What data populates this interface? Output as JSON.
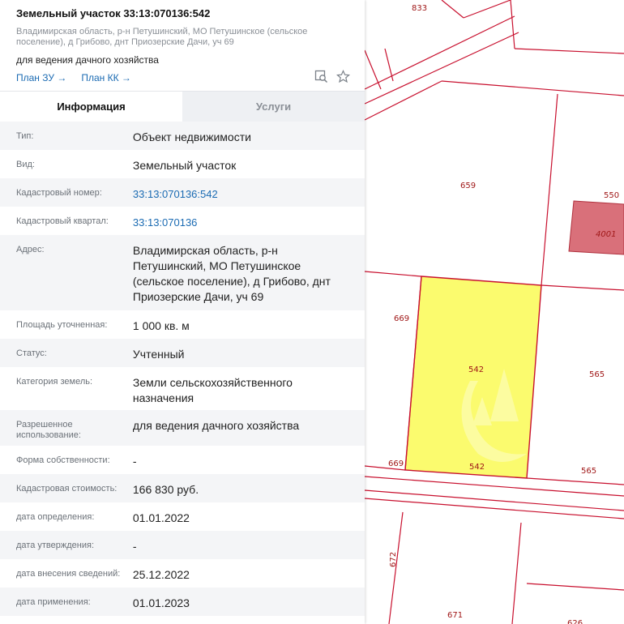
{
  "header": {
    "title": "Земельный участок 33:13:070136:542",
    "address": "Владимирская область, р-н Петушинский, МО Петушинское (сельское поселение), д Грибово, днт Приозерские Дачи, уч 69",
    "use": "для ведения дачного хозяйства",
    "link_plan_zu": "План ЗУ →",
    "link_plan_kk": "План КК →"
  },
  "tabs": [
    {
      "label": "Информация",
      "active": true
    },
    {
      "label": "Услуги",
      "active": false
    }
  ],
  "details": [
    {
      "label": "Тип:",
      "value": "Объект недвижимости"
    },
    {
      "label": "Вид:",
      "value": "Земельный участок"
    },
    {
      "label": "Кадастровый номер:",
      "value": "33:13:070136:542",
      "link": true
    },
    {
      "label": "Кадастровый квартал:",
      "value": "33:13:070136",
      "link": true
    },
    {
      "label": "Адрес:",
      "value": "Владимирская область, р-н Петушинский, МО Петушинское (сельское поселение), д Грибово, днт Приозерские Дачи, уч 69"
    },
    {
      "label": "Площадь уточненная:",
      "value": "1 000 кв. м"
    },
    {
      "label": "Статус:",
      "value": "Учтенный"
    },
    {
      "label": "Категория земель:",
      "value": "Земли сельскохозяйственного назначения"
    },
    {
      "label": "Разрешенное использование:",
      "value": "для ведения дачного хозяйства"
    },
    {
      "label": "Форма собственности:",
      "value": "-"
    },
    {
      "label": "Кадастровая стоимость:",
      "value": "166 830 руб."
    },
    {
      "label": "дата определения:",
      "value": "01.01.2022"
    },
    {
      "label": "дата утверждения:",
      "value": "-"
    },
    {
      "label": "дата внесения сведений:",
      "value": "25.12.2022"
    },
    {
      "label": "дата применения:",
      "value": "01.01.2023"
    }
  ],
  "map": {
    "labels": [
      "833",
      "659",
      "550",
      "4001",
      "669",
      "542",
      "565",
      "669",
      "542",
      "565",
      "672",
      "671",
      "626"
    ],
    "colors": {
      "boundary": "#c8102e",
      "selected_fill": "#fbfb6e",
      "building_fill": "#d9707a"
    }
  },
  "icons": [
    "map-search-icon",
    "star-icon"
  ]
}
